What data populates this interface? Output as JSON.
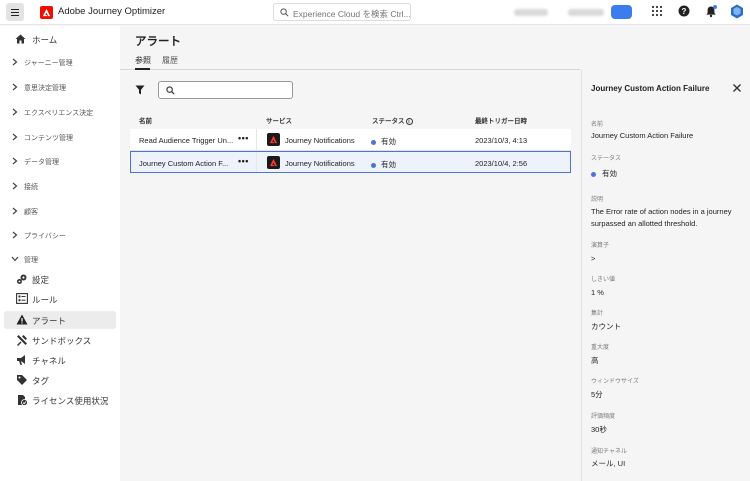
{
  "header": {
    "app_name": "Adobe Journey Optimizer",
    "search_placeholder": "Experience Cloud を検索 Ctrl..."
  },
  "sidebar": {
    "home": "ホーム",
    "sections": [
      {
        "label": "ジャーニー管理"
      },
      {
        "label": "意思決定管理"
      },
      {
        "label": "エクスペリエンス決定"
      },
      {
        "label": "コンテンツ管理"
      },
      {
        "label": "データ管理"
      },
      {
        "label": "接続"
      },
      {
        "label": "顧客"
      },
      {
        "label": "プライバシー"
      },
      {
        "label": "管理"
      }
    ],
    "admin_items": [
      {
        "label": "設定",
        "icon": "gears-icon"
      },
      {
        "label": "ルール",
        "icon": "rules-icon"
      },
      {
        "label": "アラート",
        "icon": "alert-icon"
      },
      {
        "label": "サンドボックス",
        "icon": "tools-icon"
      },
      {
        "label": "チャネル",
        "icon": "channel-icon"
      },
      {
        "label": "タグ",
        "icon": "tag-icon"
      },
      {
        "label": "ライセンス使用状況",
        "icon": "license-icon"
      }
    ]
  },
  "main": {
    "title": "アラート",
    "tabs": [
      "参照",
      "履歴"
    ],
    "columns": [
      "名前",
      "サービス",
      "ステータス",
      "最終トリガー日時"
    ],
    "rows": [
      {
        "name": "Read Audience Trigger Un...",
        "actions": "•••",
        "service": "Journey Notifications",
        "status": "有効",
        "last_triggered": "2023/10/3, 4:13"
      },
      {
        "name": "Journey Custom Action F...",
        "actions": "•••",
        "service": "Journey Notifications",
        "status": "有効",
        "last_triggered": "2023/10/4, 2:56"
      }
    ]
  },
  "panel": {
    "title": "Journey Custom Action Failure",
    "fields": [
      {
        "label": "名前",
        "value": "Journey Custom Action Failure"
      },
      {
        "label": "ステータス",
        "value": "有効"
      },
      {
        "label": "説明",
        "value": "The Error rate of action nodes in a journey surpassed an allotted threshold."
      },
      {
        "label": "演算子",
        "value": ">"
      },
      {
        "label": "しきい値",
        "value": "1 %"
      },
      {
        "label": "集計",
        "value": "カウント"
      },
      {
        "label": "重大度",
        "value": "高"
      },
      {
        "label": "ウィンドウサイズ",
        "value": "5分"
      },
      {
        "label": "評価頻度",
        "value": "30秒"
      },
      {
        "label": "通知チャネル",
        "value": "メール, UI"
      }
    ]
  },
  "colors": {
    "accent": "#4b75ce",
    "brand": "#eb1000"
  }
}
